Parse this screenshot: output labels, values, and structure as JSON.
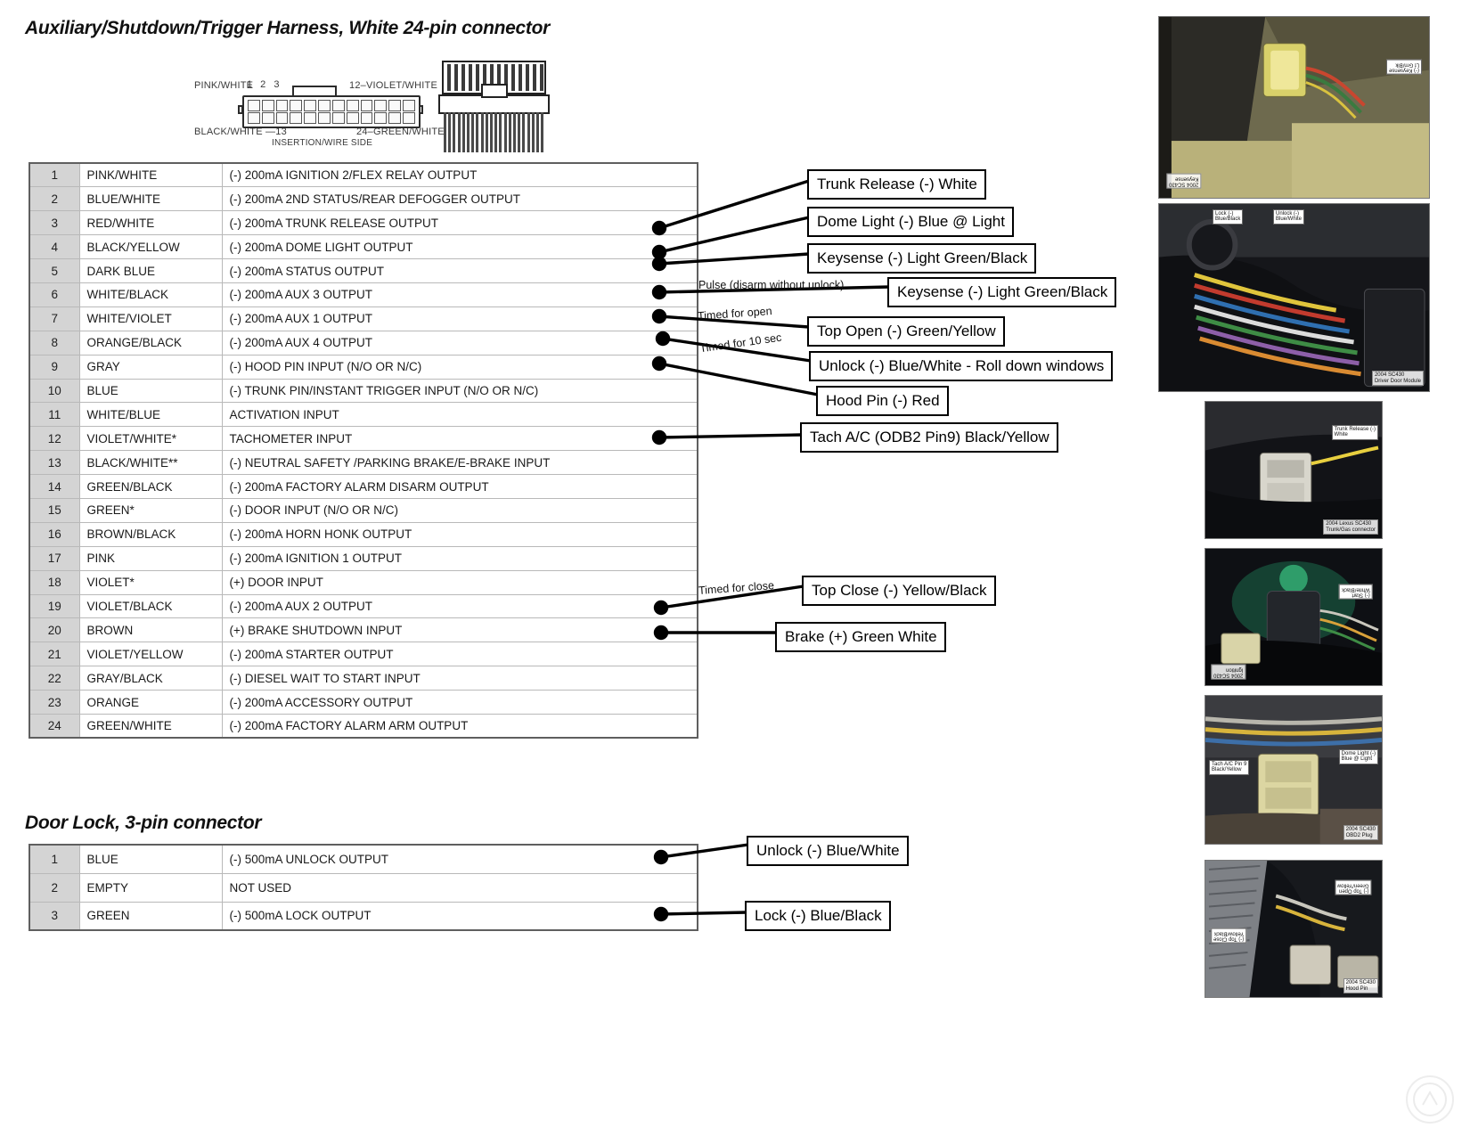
{
  "document": {
    "aux_section_title": "Auxiliary/Shutdown/Trigger Harness, White 24-pin connector",
    "door_section_title": "Door Lock, 3-pin connector"
  },
  "connector_diagram": {
    "label_top_left": "PINK/WHITE",
    "label_top_numbers": "1  2  3",
    "label_top_right": "12",
    "label_top_right_color": "VIOLET/WHITE",
    "label_bottom_left": "BLACK/WHITE",
    "label_bottom_left_pin": "13",
    "label_bottom_right_pin": "24",
    "label_bottom_right_color": "GREEN/WHITE",
    "caption": "INSERTION/WIRE SIDE"
  },
  "aux_table": {
    "rows": [
      {
        "pin": "1",
        "color": "PINK/WHITE",
        "description": "(-) 200mA IGNITION 2/FLEX RELAY OUTPUT"
      },
      {
        "pin": "2",
        "color": "BLUE/WHITE",
        "description": "(-) 200mA 2ND STATUS/REAR DEFOGGER OUTPUT"
      },
      {
        "pin": "3",
        "color": "RED/WHITE",
        "description": "(-) 200mA TRUNK RELEASE OUTPUT"
      },
      {
        "pin": "4",
        "color": "BLACK/YELLOW",
        "description": "(-) 200mA DOME LIGHT OUTPUT"
      },
      {
        "pin": "5",
        "color": "DARK BLUE",
        "description": "(-) 200mA STATUS OUTPUT"
      },
      {
        "pin": "6",
        "color": "WHITE/BLACK",
        "description": "(-) 200mA AUX 3 OUTPUT"
      },
      {
        "pin": "7",
        "color": "WHITE/VIOLET",
        "description": "(-) 200mA AUX 1 OUTPUT"
      },
      {
        "pin": "8",
        "color": "ORANGE/BLACK",
        "description": "(-) 200mA AUX 4 OUTPUT"
      },
      {
        "pin": "9",
        "color": "GRAY",
        "description": "(-) HOOD PIN INPUT (N/O OR N/C)"
      },
      {
        "pin": "10",
        "color": "BLUE",
        "description": "(-) TRUNK PIN/INSTANT TRIGGER INPUT (N/O OR N/C)"
      },
      {
        "pin": "11",
        "color": "WHITE/BLUE",
        "description": "ACTIVATION INPUT"
      },
      {
        "pin": "12",
        "color": "VIOLET/WHITE*",
        "description": "TACHOMETER INPUT"
      },
      {
        "pin": "13",
        "color": "BLACK/WHITE**",
        "description": "(-) NEUTRAL SAFETY /PARKING BRAKE/E-BRAKE INPUT"
      },
      {
        "pin": "14",
        "color": "GREEN/BLACK",
        "description": "(-) 200mA FACTORY ALARM DISARM OUTPUT"
      },
      {
        "pin": "15",
        "color": "GREEN*",
        "description": "(-) DOOR INPUT (N/O OR N/C)"
      },
      {
        "pin": "16",
        "color": "BROWN/BLACK",
        "description": "(-) 200mA HORN HONK OUTPUT"
      },
      {
        "pin": "17",
        "color": "PINK",
        "description": "(-) 200mA IGNITION 1 OUTPUT"
      },
      {
        "pin": "18",
        "color": "VIOLET*",
        "description": "(+) DOOR INPUT"
      },
      {
        "pin": "19",
        "color": "VIOLET/BLACK",
        "description": "(-) 200mA AUX 2 OUTPUT"
      },
      {
        "pin": "20",
        "color": "BROWN",
        "description": "(+) BRAKE SHUTDOWN INPUT"
      },
      {
        "pin": "21",
        "color": "VIOLET/YELLOW",
        "description": "(-) 200mA STARTER OUTPUT"
      },
      {
        "pin": "22",
        "color": "GRAY/BLACK",
        "description": "(-) DIESEL WAIT TO START INPUT"
      },
      {
        "pin": "23",
        "color": "ORANGE",
        "description": "(-) 200mA ACCESSORY OUTPUT"
      },
      {
        "pin": "24",
        "color": "GREEN/WHITE",
        "description": "(-) 200mA FACTORY ALARM ARM OUTPUT"
      }
    ]
  },
  "door_table": {
    "rows": [
      {
        "pin": "1",
        "color": "BLUE",
        "description": "(-) 500mA UNLOCK OUTPUT"
      },
      {
        "pin": "2",
        "color": "EMPTY",
        "description": "NOT USED"
      },
      {
        "pin": "3",
        "color": "GREEN",
        "description": "(-) 500mA LOCK OUTPUT"
      }
    ]
  },
  "callouts": [
    {
      "id": "trunk_release",
      "text": "Trunk Release (-) White"
    },
    {
      "id": "dome_light",
      "text": "Dome Light (-) Blue @ Light"
    },
    {
      "id": "keysense_1",
      "text": "Keysense (-) Light Green/Black"
    },
    {
      "id": "keysense_2",
      "text": "Keysense (-) Light Green/Black"
    },
    {
      "id": "top_open",
      "text": "Top Open (-) Green/Yellow"
    },
    {
      "id": "unlock_roll",
      "text": "Unlock (-) Blue/White - Roll down windows"
    },
    {
      "id": "hood_pin",
      "text": "Hood Pin (-) Red"
    },
    {
      "id": "tach",
      "text": "Tach A/C (ODB2 Pin9) Black/Yellow"
    },
    {
      "id": "top_close",
      "text": "Top Close (-) Yellow/Black"
    },
    {
      "id": "brake",
      "text": "Brake (+) Green White"
    },
    {
      "id": "unlock",
      "text": "Unlock (-) Blue/White"
    },
    {
      "id": "lock",
      "text": "Lock (-) Blue/Black"
    }
  ],
  "leader_notes": [
    {
      "id": "note_pulse",
      "text": "Pulse (disarm without unlock)"
    },
    {
      "id": "note_open",
      "text": "Timed for open"
    },
    {
      "id": "note_10sec",
      "text": "Timed for 10 sec"
    },
    {
      "id": "note_close",
      "text": "Timed for close"
    }
  ],
  "photos": [
    {
      "id": "photo_keysense",
      "caption": "2004 SC430\nKeysense",
      "tag": "(-) Keysense\nLt Grn/Blk"
    },
    {
      "id": "photo_door_module",
      "caption": "2004 SC430\nDriver Door Module",
      "tag_lock": "Lock (-)\nBlue/Black",
      "tag_unlock": "Unlock (-)\nBlue/White"
    },
    {
      "id": "photo_trunk",
      "caption": "2004 Lexus SC430\nTrunk/Gas connector",
      "tag": "Trunk Release (-)\nWhite"
    },
    {
      "id": "photo_ignition",
      "caption": "2004 SC430\nIgnition",
      "tag": "(-) Start\nWhite/Black"
    },
    {
      "id": "photo_obd2",
      "caption": "2004 SC430\nOBD2 Plug",
      "tag_tach": "Tach A/C Pin 9\nBlack/Yellow",
      "tag_dome": "Dome Light (-)\nBlue @ Light"
    },
    {
      "id": "photo_engine",
      "caption": "2004 SC430\nHood Pin",
      "tag_top": "(-) Top Open\nGreen/Yellow",
      "tag_bottom": "(-) Top Close\nYellow/Black"
    }
  ],
  "colors": {
    "table_border": "#5f5f5f",
    "pin_cell_bg": "#d4d4d4",
    "grid_line": "#b9b9b9",
    "callout_border": "#000000",
    "text": "#1a1a1a"
  }
}
